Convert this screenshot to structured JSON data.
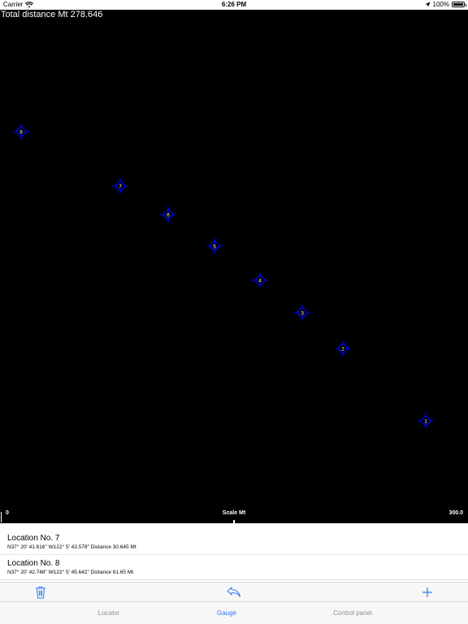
{
  "status": {
    "carrier": "Carrier",
    "time": "6:26 PM",
    "battery": "100%"
  },
  "map": {
    "total_distance": "Total distance Mt 278.646",
    "marker_color": "#0000ff",
    "markers": [
      "1",
      "2",
      "3",
      "4",
      "5",
      "6",
      "7",
      "8"
    ],
    "scale": {
      "left": "0",
      "label": "Scale Mt",
      "right": "300.0"
    }
  },
  "locations": [
    {
      "title": "Location No. 7",
      "detail": "N37° 20' 41.616\" W122° 5' 43.578\" Distance 30.645 Mt"
    },
    {
      "title": "Location No. 8",
      "detail": "N37° 20' 42.748\" W122° 5' 45.642\" Distance 61.65 Mt"
    }
  ],
  "toolbar": {
    "icons": [
      "trash-icon",
      "undo-icon",
      "plus-icon"
    ],
    "accent": "#2a7bf6"
  },
  "tabs": [
    {
      "label": "Locator",
      "active": false
    },
    {
      "label": "Gauge",
      "active": true
    },
    {
      "label": "Control panel",
      "active": false
    }
  ]
}
